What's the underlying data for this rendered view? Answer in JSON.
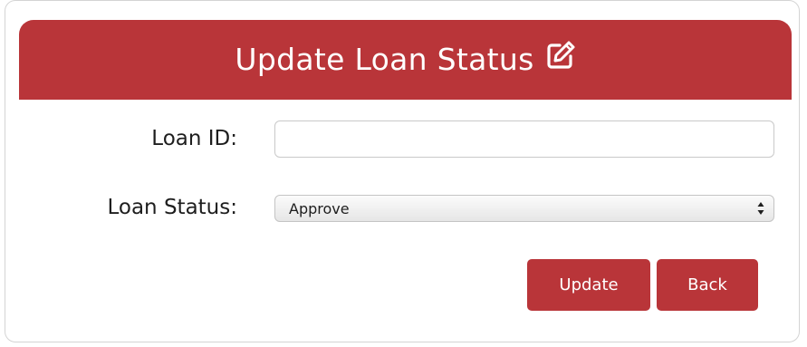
{
  "header": {
    "title": "Update Loan Status",
    "icon": "edit-icon"
  },
  "form": {
    "loan_id_label": "Loan ID:",
    "loan_id_value": "",
    "loan_status_label": "Loan Status:",
    "loan_status_selected": "Approve"
  },
  "buttons": {
    "update_label": "Update",
    "back_label": "Back"
  },
  "colors": {
    "accent": "#b93539",
    "text": "#1e1e1e",
    "background": "#ffffff"
  }
}
